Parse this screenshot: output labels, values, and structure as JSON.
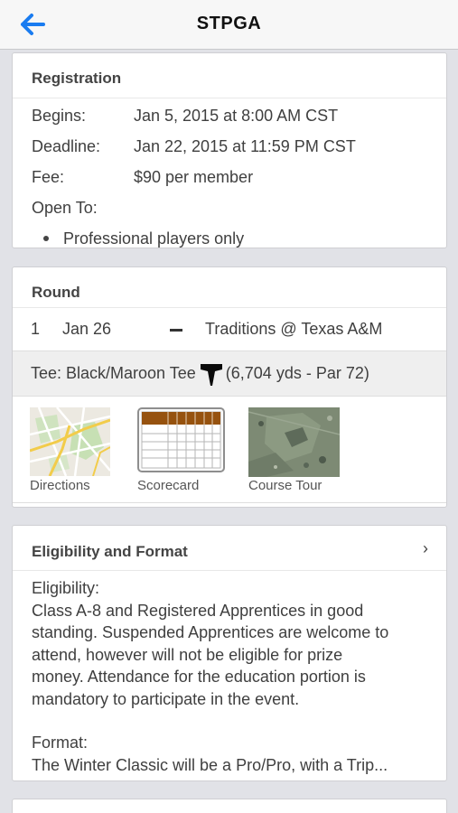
{
  "nav": {
    "title": "STPGA",
    "back_icon": "back-arrow-icon",
    "accent": "#1a7cf0"
  },
  "registration": {
    "header": "Registration",
    "rows": [
      {
        "label": "Begins:",
        "value": "Jan 5, 2015 at 8:00 AM CST"
      },
      {
        "label": "Deadline:",
        "value": "Jan 22, 2015 at 11:59 PM CST"
      },
      {
        "label": "Fee:",
        "value": "$90 per member"
      }
    ],
    "open_to_label": "Open To:",
    "open_to_items": [
      "Professional players only"
    ]
  },
  "round": {
    "header": "Round",
    "number": "1",
    "date": "Jan 26",
    "separator": "–",
    "course": "Traditions @ Texas A&M",
    "tee_label": "Tee: Black/Maroon Tee",
    "tee_icon": "tee-marker-icon",
    "tee_details": "(6,704 yds - Par 72)",
    "tiles": [
      {
        "caption": "Directions",
        "icon": "map-thumbnail"
      },
      {
        "caption": "Scorecard",
        "icon": "scorecard-icon"
      },
      {
        "caption": "Course Tour",
        "icon": "aerial-photo-thumbnail"
      }
    ]
  },
  "eligibility": {
    "header": "Eligibility and Format",
    "chevron": "›",
    "elig_label": "Eligibility:",
    "elig_lines": [
      "Class A-8 and Registered Apprentices in good",
      "standing. Suspended Apprentices are welcome to",
      "attend, however will not be eligible for prize",
      "money. Attendance for the education portion is",
      "mandatory to participate in the event."
    ],
    "format_label": "Format:",
    "format_text": "The Winter Classic will be a Pro/Pro, with a Trip..."
  }
}
